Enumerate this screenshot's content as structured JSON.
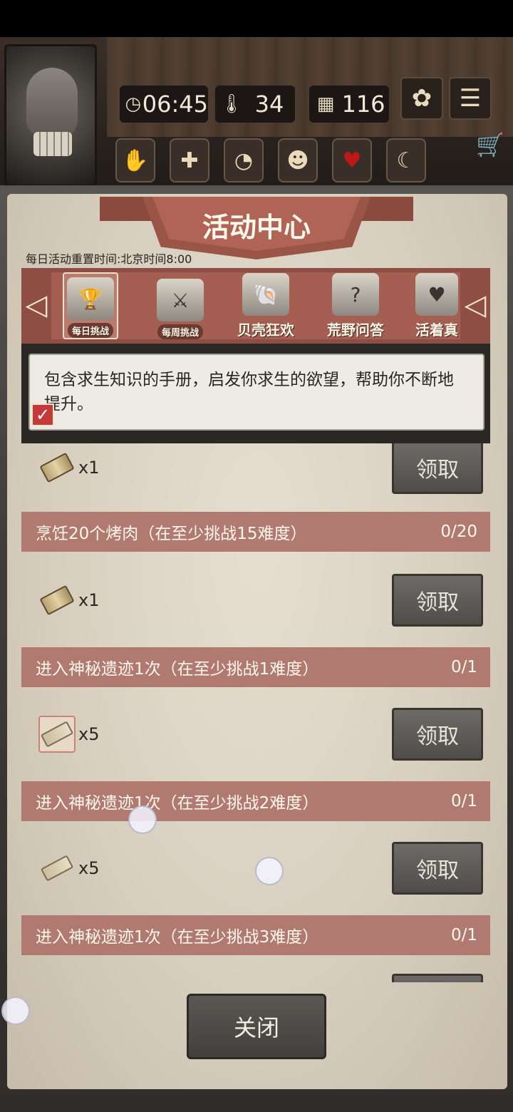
{
  "hud": {
    "time": "06:45",
    "temperature": "34",
    "days": "116",
    "icons": [
      "clock-icon",
      "thermometer-icon",
      "calendar-icon",
      "sunflower-icon",
      "menu-icon"
    ]
  },
  "status_icons": [
    "hand-bandage-icon",
    "medical-cross-icon",
    "stomach-icon",
    "head-mind-icon",
    "heart-icon",
    "moon-sleep-icon"
  ],
  "panel": {
    "title": "活动中心",
    "reset_note": "每日活动重置时间:北京时间8:00"
  },
  "tabs": [
    {
      "label": "每日挑战",
      "icon": "trophy-icon",
      "active": true
    },
    {
      "label": "每周挑战",
      "icon": "trophy-swords-icon",
      "active": false
    },
    {
      "label": "贝壳狂欢",
      "icon": "shell-icon",
      "active": false
    },
    {
      "label": "荒野问答",
      "icon": "question-bubble-icon",
      "active": false
    },
    {
      "label": "活着真",
      "icon": "calendar-heart-icon",
      "active": false
    }
  ],
  "tooltip": {
    "text": "包含求生知识的手册，启发你求生的欲望，帮助你不断地提升。"
  },
  "tasks": [
    {
      "title": null,
      "progress": null,
      "reward_qty": "x1",
      "reward_icon": "manual-book-icon",
      "claim": "领取"
    },
    {
      "title": "烹饪20个烤肉（在至少挑战15难度）",
      "progress": "0/20",
      "reward_qty": "x1",
      "reward_icon": "manual-book-icon",
      "claim": "领取"
    },
    {
      "title": "进入神秘遗迹1次（在至少挑战1难度）",
      "progress": "0/1",
      "reward_qty": "x5",
      "reward_icon": "paper-scroll-icon",
      "claim": "领取"
    },
    {
      "title": "进入神秘遗迹1次（在至少挑战2难度）",
      "progress": "0/1",
      "reward_qty": "x5",
      "reward_icon": "paper-scroll-icon",
      "claim": "领取"
    },
    {
      "title": "进入神秘遗迹1次（在至少挑战3难度）",
      "progress": "0/1",
      "reward_qty": null,
      "reward_icon": null,
      "claim": null
    }
  ],
  "close_label": "关闭"
}
